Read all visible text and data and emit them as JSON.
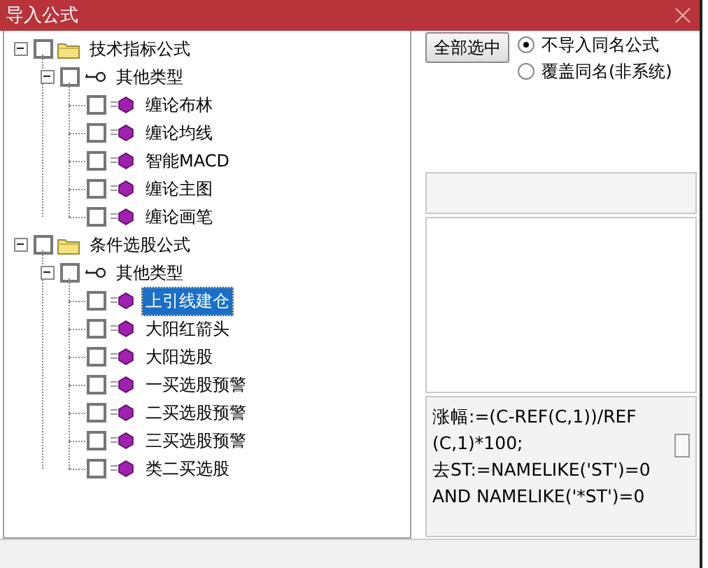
{
  "window": {
    "title": "导入公式"
  },
  "tree": [
    {
      "kind": "folder",
      "label": "技术指标公式",
      "checked": false,
      "expanded": true,
      "children": [
        {
          "kind": "group",
          "label": "其他类型",
          "checked": false,
          "expanded": true,
          "children": [
            {
              "kind": "formula",
              "label": "缠论布林",
              "checked": false,
              "selected": false
            },
            {
              "kind": "formula",
              "label": "缠论均线",
              "checked": false,
              "selected": false
            },
            {
              "kind": "formula",
              "label": "智能MACD",
              "checked": false,
              "selected": false
            },
            {
              "kind": "formula",
              "label": "缠论主图",
              "checked": false,
              "selected": false
            },
            {
              "kind": "formula",
              "label": "缠论画笔",
              "checked": false,
              "selected": false
            }
          ]
        }
      ]
    },
    {
      "kind": "folder",
      "label": "条件选股公式",
      "checked": false,
      "expanded": true,
      "children": [
        {
          "kind": "group",
          "label": "其他类型",
          "checked": false,
          "expanded": true,
          "children": [
            {
              "kind": "formula",
              "label": "上引线建仓",
              "checked": false,
              "selected": true
            },
            {
              "kind": "formula",
              "label": "大阳红箭头",
              "checked": false,
              "selected": false
            },
            {
              "kind": "formula",
              "label": "大阳选股",
              "checked": false,
              "selected": false
            },
            {
              "kind": "formula",
              "label": "一买选股预警",
              "checked": false,
              "selected": false
            },
            {
              "kind": "formula",
              "label": "二买选股预警",
              "checked": false,
              "selected": false
            },
            {
              "kind": "formula",
              "label": "三买选股预警",
              "checked": false,
              "selected": false
            },
            {
              "kind": "formula",
              "label": "类二买选股",
              "checked": false,
              "selected": false
            }
          ]
        }
      ]
    }
  ],
  "select_all_button": "全部选中",
  "options": [
    {
      "label": "不导入同名公式",
      "selected": true
    },
    {
      "label": "覆盖同名(非系统)",
      "selected": false
    }
  ],
  "formula_text": "涨幅:=(C-REF(C,1))/REF\n(C,1)*100;\n去ST:=NAMELIKE('ST')=0\nAND NAMELIKE('*ST')=0"
}
